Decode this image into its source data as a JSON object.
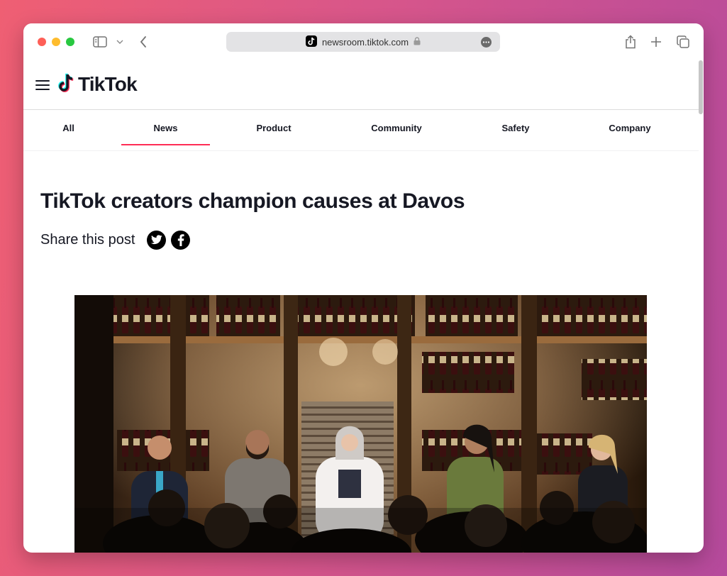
{
  "browser": {
    "url": "newsroom.tiktok.com",
    "icons": {
      "sidebar": "sidebar-icon",
      "back": "chevron-left-icon",
      "lock": "lock-icon",
      "more": "ellipsis-icon",
      "share": "share-icon",
      "new_tab": "plus-icon",
      "tabs": "tab-overview-icon"
    }
  },
  "site": {
    "brand": "TikTok",
    "brand_colors": {
      "cyan": "#25f4ee",
      "red": "#fe2c55",
      "dark": "#161823"
    },
    "nav": {
      "items": [
        {
          "label": "All",
          "active": false
        },
        {
          "label": "News",
          "active": true
        },
        {
          "label": "Product",
          "active": false
        },
        {
          "label": "Community",
          "active": false
        },
        {
          "label": "Safety",
          "active": false
        },
        {
          "label": "Company",
          "active": false
        }
      ]
    }
  },
  "article": {
    "title": "TikTok creators champion causes at Davos",
    "share_label": "Share this post",
    "share_icons": [
      "twitter-icon",
      "facebook-icon"
    ]
  }
}
